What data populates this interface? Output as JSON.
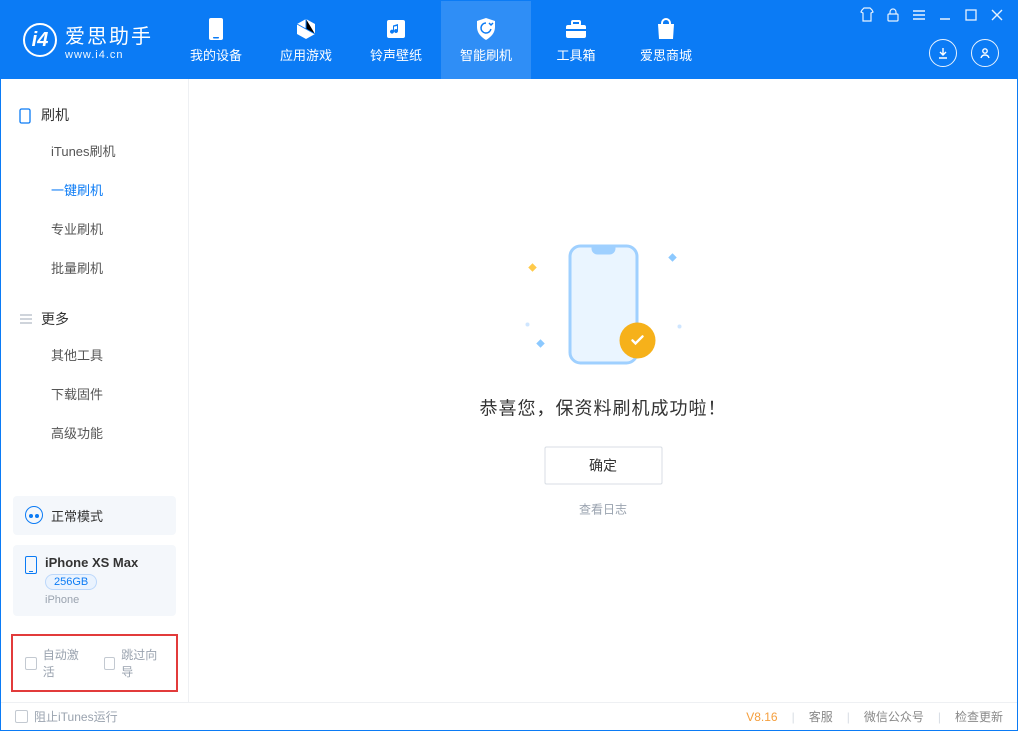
{
  "app": {
    "name": "爱思助手",
    "site": "www.i4.cn"
  },
  "nav": {
    "items": [
      {
        "label": "我的设备"
      },
      {
        "label": "应用游戏"
      },
      {
        "label": "铃声壁纸"
      },
      {
        "label": "智能刷机"
      },
      {
        "label": "工具箱"
      },
      {
        "label": "爱思商城"
      }
    ]
  },
  "sidebar": {
    "group1": {
      "title": "刷机",
      "items": [
        {
          "label": "iTunes刷机"
        },
        {
          "label": "一键刷机"
        },
        {
          "label": "专业刷机"
        },
        {
          "label": "批量刷机"
        }
      ]
    },
    "group2": {
      "title": "更多",
      "items": [
        {
          "label": "其他工具"
        },
        {
          "label": "下载固件"
        },
        {
          "label": "高级功能"
        }
      ]
    },
    "mode_label": "正常模式",
    "device": {
      "name": "iPhone XS Max",
      "storage": "256GB",
      "type": "iPhone"
    },
    "checks": {
      "auto_activate": "自动激活",
      "skip_guide": "跳过向导"
    }
  },
  "main": {
    "success_text": "恭喜您，保资料刷机成功啦！",
    "ok_label": "确定",
    "log_link": "查看日志"
  },
  "footer": {
    "block_itunes": "阻止iTunes运行",
    "version": "V8.16",
    "links": {
      "service": "客服",
      "wechat": "微信公众号",
      "update": "检查更新"
    }
  }
}
